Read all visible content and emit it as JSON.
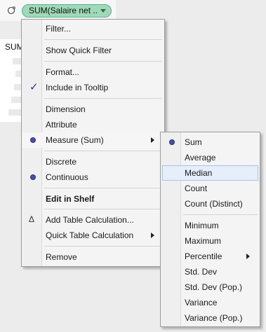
{
  "shelf": {
    "pill_label": "SUM(Salaire net ..",
    "sum_label": "SUM"
  },
  "context_menu": {
    "items": [
      {
        "label": "Filter...",
        "mark": ""
      },
      {
        "label": "Show Quick Filter",
        "mark": ""
      },
      {
        "label": "Format...",
        "mark": ""
      },
      {
        "label": "Include in Tooltip",
        "mark": "check"
      },
      {
        "label": "Dimension",
        "mark": ""
      },
      {
        "label": "Attribute",
        "mark": ""
      },
      {
        "label": "Measure (Sum)",
        "mark": "dot",
        "submenu": true
      },
      {
        "label": "Discrete",
        "mark": ""
      },
      {
        "label": "Continuous",
        "mark": "dot"
      },
      {
        "label": "Edit in Shelf",
        "mark": ""
      },
      {
        "label": "Add Table Calculation...",
        "mark": "delta"
      },
      {
        "label": "Quick Table Calculation",
        "mark": "",
        "submenu": true
      },
      {
        "label": "Remove",
        "mark": ""
      }
    ]
  },
  "measure_submenu": {
    "items": [
      {
        "label": "Sum",
        "mark": "dot"
      },
      {
        "label": "Average",
        "mark": ""
      },
      {
        "label": "Median",
        "mark": "",
        "highlighted": true
      },
      {
        "label": "Count",
        "mark": ""
      },
      {
        "label": "Count (Distinct)",
        "mark": ""
      },
      {
        "label": "Minimum",
        "mark": ""
      },
      {
        "label": "Maximum",
        "mark": ""
      },
      {
        "label": "Percentile",
        "mark": "",
        "submenu": true
      },
      {
        "label": "Std. Dev",
        "mark": ""
      },
      {
        "label": "Std. Dev (Pop.)",
        "mark": ""
      },
      {
        "label": "Variance",
        "mark": ""
      },
      {
        "label": "Variance (Pop.)",
        "mark": ""
      }
    ]
  },
  "colors": {
    "pill_fill": "#9ed9b8",
    "pill_border": "#58b487",
    "radio_dot": "#4a4fa6",
    "highlight": "#e6eefb"
  }
}
